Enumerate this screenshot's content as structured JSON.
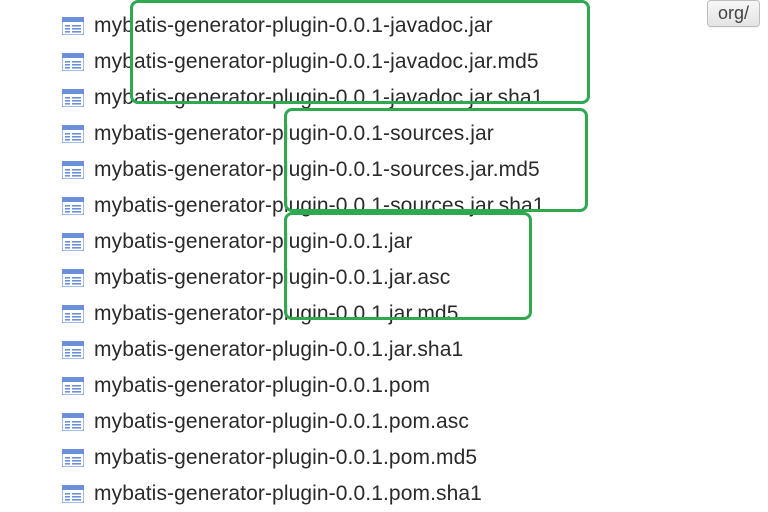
{
  "top_button_label": "org/",
  "files": {
    "items": [
      {
        "name": "mybatis-generator-plugin-0.0.1-javadoc.jar"
      },
      {
        "name": "mybatis-generator-plugin-0.0.1-javadoc.jar.md5"
      },
      {
        "name": "mybatis-generator-plugin-0.0.1-javadoc.jar.sha1"
      },
      {
        "name": "mybatis-generator-plugin-0.0.1-sources.jar"
      },
      {
        "name": "mybatis-generator-plugin-0.0.1-sources.jar.md5"
      },
      {
        "name": "mybatis-generator-plugin-0.0.1-sources.jar.sha1"
      },
      {
        "name": "mybatis-generator-plugin-0.0.1.jar"
      },
      {
        "name": "mybatis-generator-plugin-0.0.1.jar.asc"
      },
      {
        "name": "mybatis-generator-plugin-0.0.1.jar.md5"
      },
      {
        "name": "mybatis-generator-plugin-0.0.1.jar.sha1"
      },
      {
        "name": "mybatis-generator-plugin-0.0.1.pom"
      },
      {
        "name": "mybatis-generator-plugin-0.0.1.pom.asc"
      },
      {
        "name": "mybatis-generator-plugin-0.0.1.pom.md5"
      },
      {
        "name": "mybatis-generator-plugin-0.0.1.pom.sha1"
      }
    ]
  }
}
